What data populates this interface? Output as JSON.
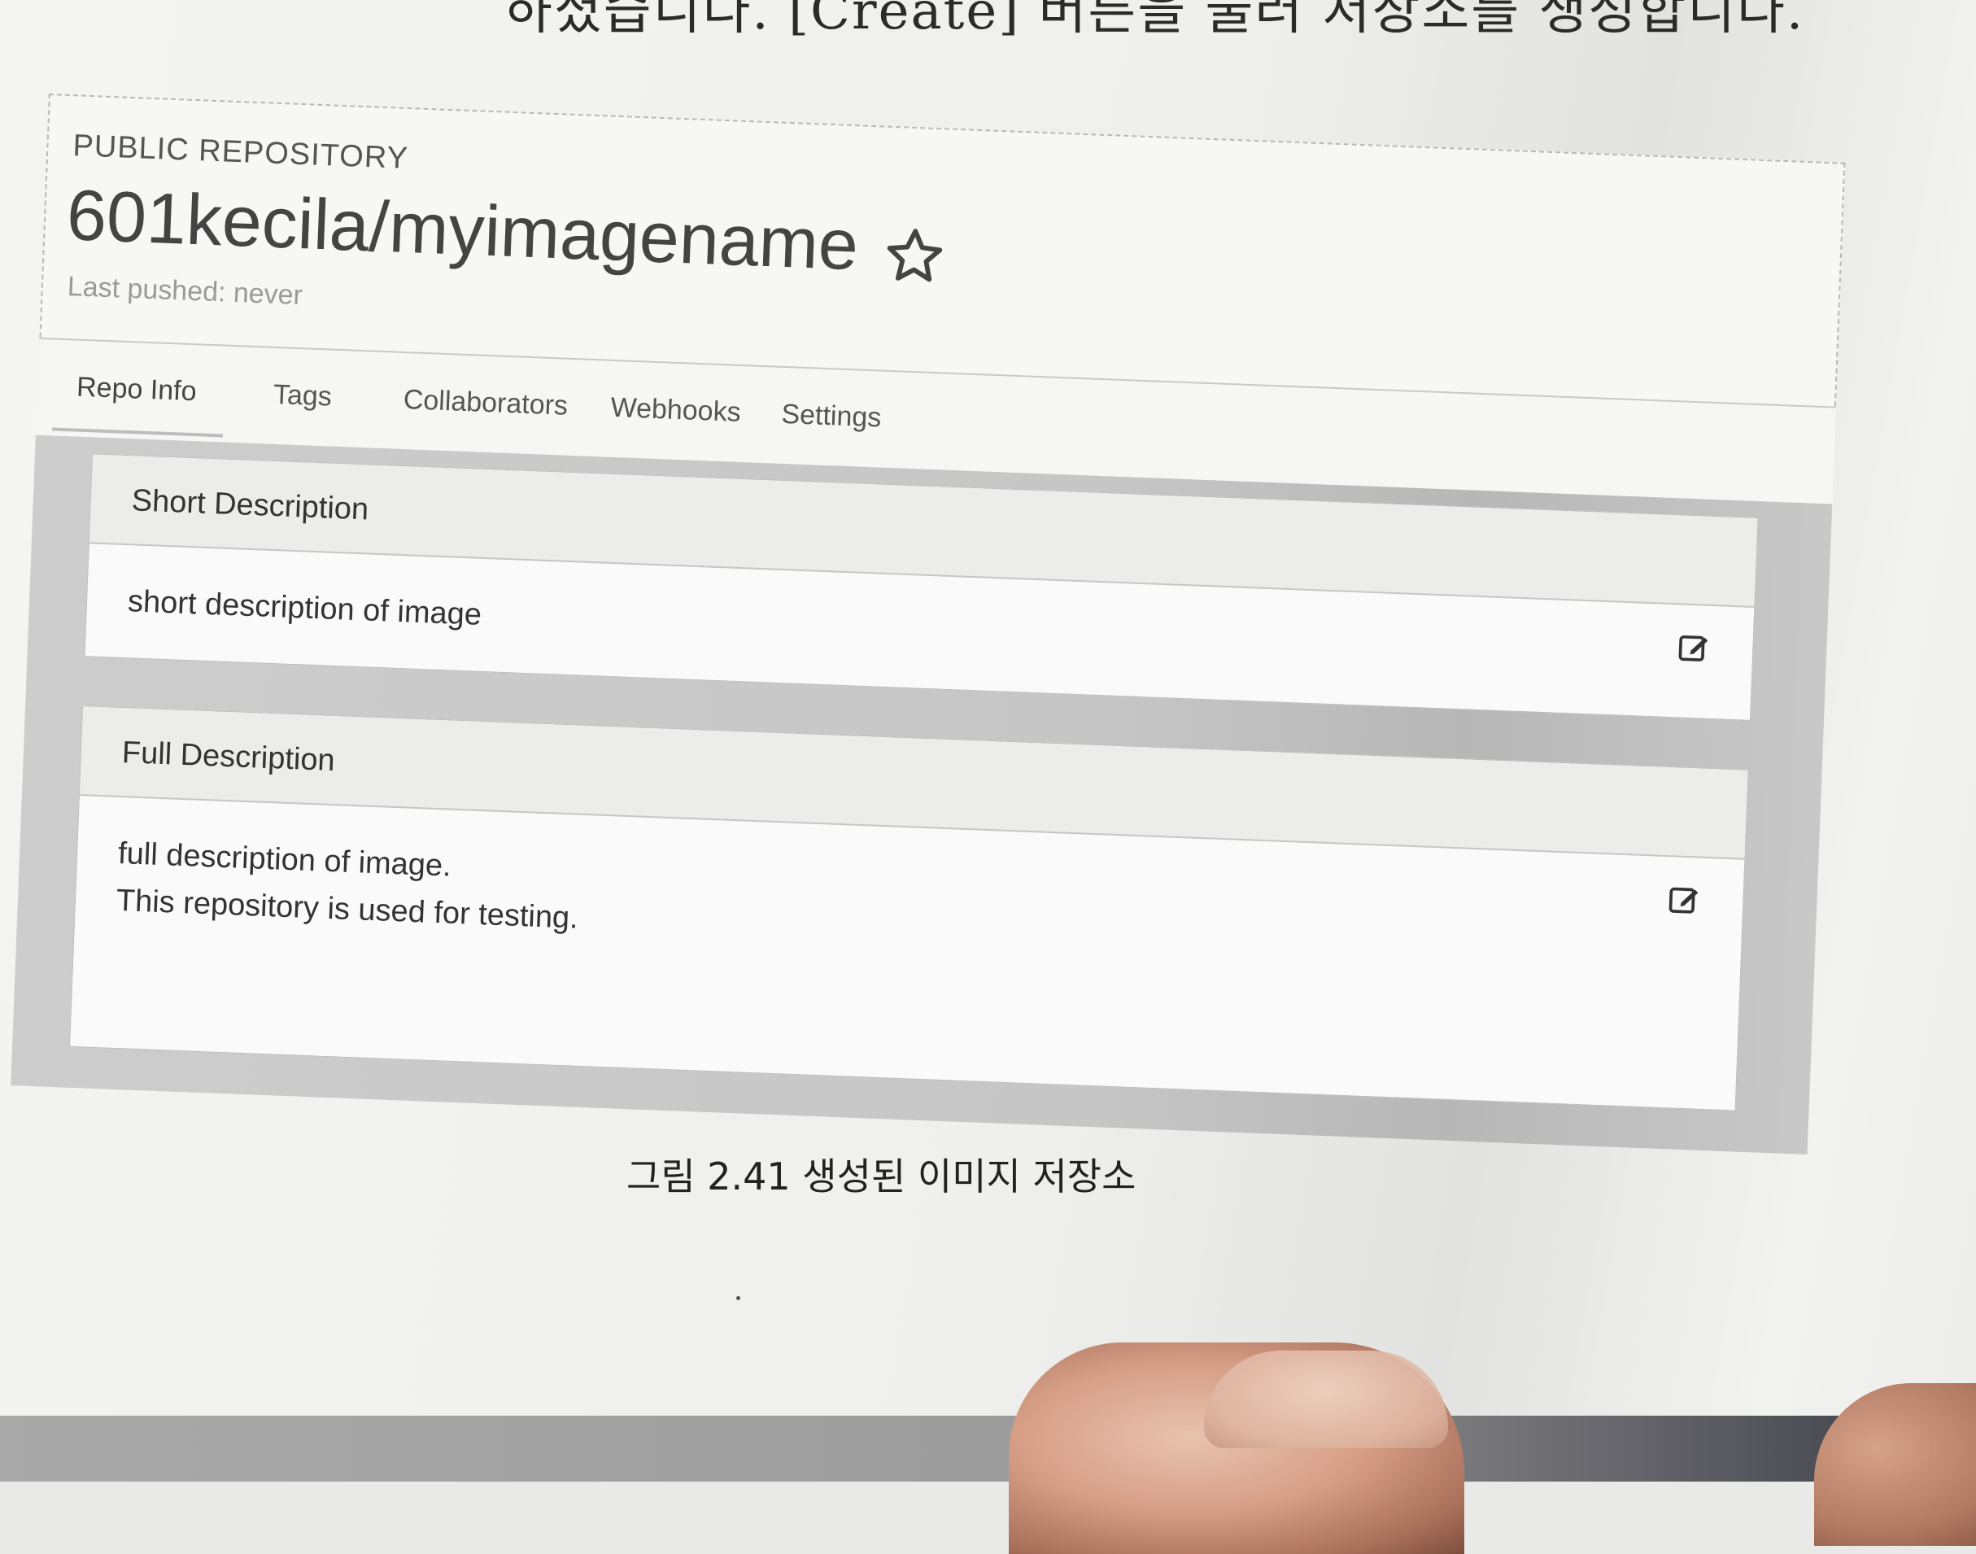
{
  "book": {
    "top_text": "하셨습니다. [Create] 버튼을 눌러 저장소를 생성합니다."
  },
  "repo": {
    "visibility_label": "PUBLIC REPOSITORY",
    "name": "601kecila/myimagename",
    "last_pushed": "Last pushed: never",
    "star_icon": "star-outline-icon"
  },
  "tabs": [
    {
      "label": "Repo Info",
      "active": true
    },
    {
      "label": "Tags",
      "active": false
    },
    {
      "label": "Collaborators",
      "active": false
    },
    {
      "label": "Webhooks",
      "active": false
    },
    {
      "label": "Settings",
      "active": false
    }
  ],
  "short_description": {
    "title": "Short Description",
    "text": "short description of image",
    "edit_icon": "edit-icon"
  },
  "full_description": {
    "title": "Full Description",
    "lines": [
      "full description of image.",
      "This repository is used for testing."
    ],
    "edit_icon": "edit-icon"
  },
  "caption": "그림 2.41 생성된 이미지 저장소"
}
